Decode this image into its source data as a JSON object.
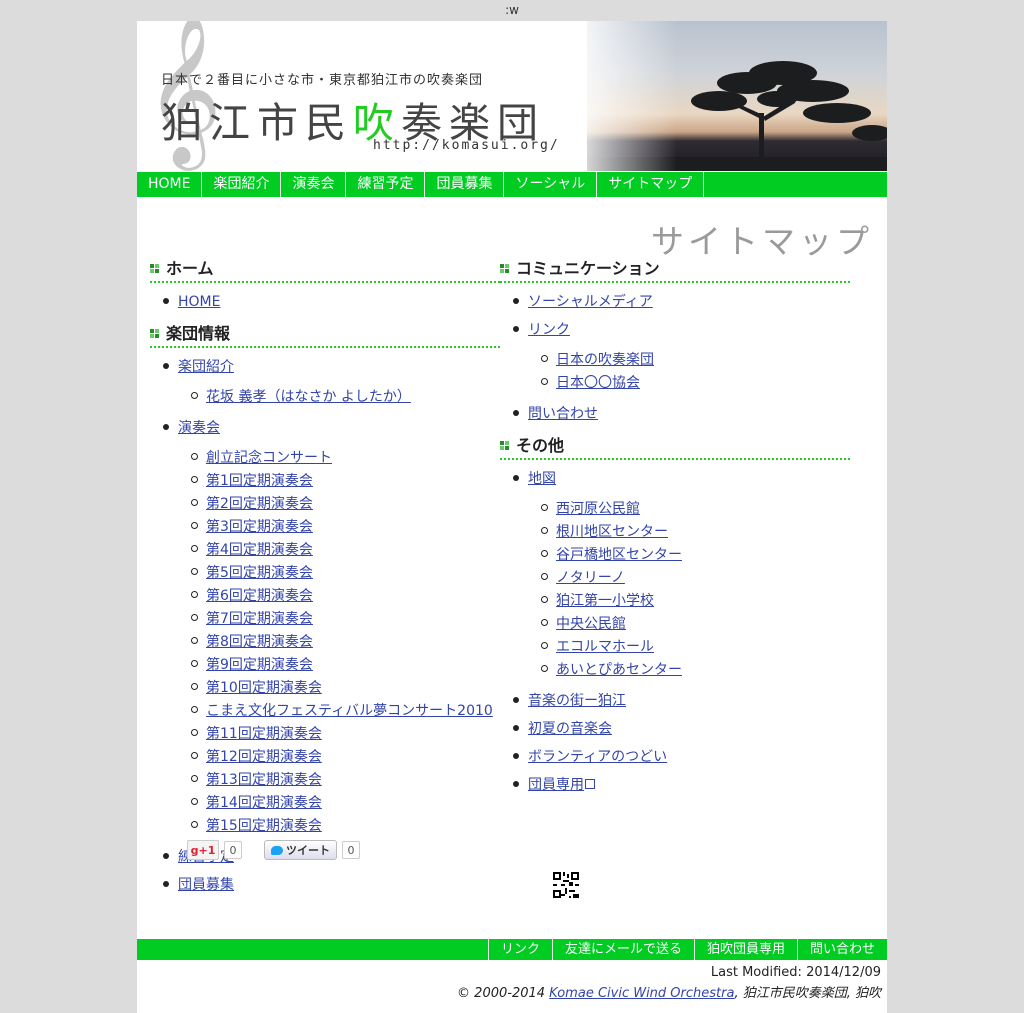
{
  "top_strip": ":w",
  "header": {
    "clef_icon": "treble-clef",
    "tagline": "日本で２番目に小さな市・東京都狛江市の吹奏楽団",
    "title_before": "狛江市民",
    "title_accent": "吹",
    "title_after": "奏楽団",
    "url": "http://komasui.org/"
  },
  "nav": {
    "items": [
      {
        "label": "HOME"
      },
      {
        "label": "楽団紹介"
      },
      {
        "label": "演奏会"
      },
      {
        "label": "練習予定"
      },
      {
        "label": "団員募集"
      },
      {
        "label": "ソーシャル"
      },
      {
        "label": "サイトマップ"
      }
    ]
  },
  "page_heading": "サイトマップ",
  "sections": {
    "home": {
      "title": "ホーム",
      "items": [
        "HOME"
      ]
    },
    "info": {
      "title": "楽団情報",
      "intro": "楽団紹介",
      "intro_children": [
        "花坂 義孝（はなさか よしたか）"
      ],
      "concerts": "演奏会",
      "concert_children": [
        "創立記念コンサート",
        "第1回定期演奏会",
        "第2回定期演奏会",
        "第3回定期演奏会",
        "第4回定期演奏会",
        "第5回定期演奏会",
        "第6回定期演奏会",
        "第7回定期演奏会",
        "第8回定期演奏会",
        "第9回定期演奏会",
        "第10回定期演奏会",
        "こまえ文化フェスティバル夢コンサート2010",
        "第11回定期演奏会",
        "第12回定期演奏会",
        "第13回定期演奏会",
        "第14回定期演奏会",
        "第15回定期演奏会"
      ],
      "practice": "練習予定",
      "recruit": "団員募集"
    },
    "communication": {
      "title": "コミュニケーション",
      "social": "ソーシャルメディア",
      "links": "リンク",
      "link_children": [
        "日本の吹奏楽団",
        "日本〇〇協会"
      ],
      "contact": "問い合わせ"
    },
    "other": {
      "title": "その他",
      "map": "地図",
      "map_children": [
        "西河原公民館",
        "根川地区センター",
        "谷戸橋地区センター",
        "ノタリーノ",
        "狛江第一小学校",
        "中央公民館",
        "エコルマホール",
        "あいとぴあセンター"
      ],
      "town": "音楽の街ー狛江",
      "summer": "初夏の音楽会",
      "volunteer": "ボランティアのつどい",
      "members": "団員専用"
    }
  },
  "social": {
    "gplus_label": "+1",
    "gplus_count": "0",
    "tweet_label": "ツイート",
    "tweet_count": "0"
  },
  "footer": {
    "nav": [
      {
        "label": "リンク"
      },
      {
        "label": "友達にメールで送る"
      },
      {
        "label": "狛吹団員専用"
      },
      {
        "label": "問い合わせ"
      }
    ],
    "last_modified": "Last Modified: 2014/12/09",
    "copyright_prefix": "© 2000-2014 ",
    "copyright_link": "Komae Civic Wind Orchestra",
    "copyright_suffix": ", 狛江市民吹奏楽団, 狛吹"
  },
  "colors": {
    "accent_green": "#00cc22",
    "link_blue": "#3344aa",
    "heading_gray": "#9a9a9a"
  }
}
